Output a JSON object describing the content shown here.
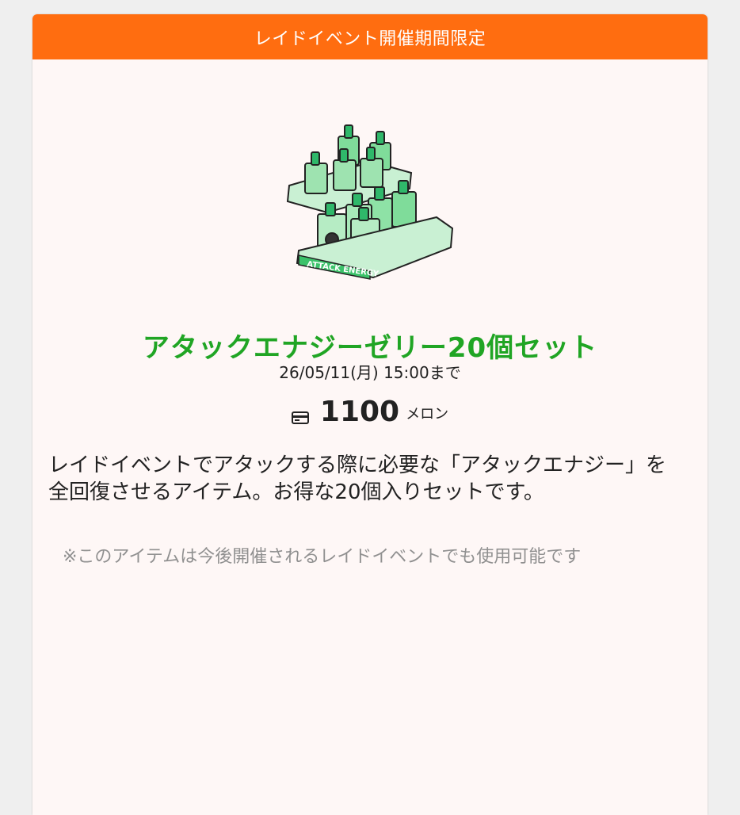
{
  "banner": {
    "label": "レイドイベント開催期間限定"
  },
  "item": {
    "name": "アタックエナジーゼリー20個セット",
    "deadline": "26/05/11(月) 15:00まで",
    "price": "1100",
    "price_unit": "メロン",
    "image_text": "ATTACK ENERGY",
    "description": "レイドイベントでアタックする際に必要な「アタックエナジー」を全回復させるアイテム。お得な20個入りセットです。",
    "note": "※このアイテムは今後開催されるレイドイベントでも使用可能です"
  },
  "colors": {
    "banner": "#ff6d10",
    "item_name": "#20a524",
    "note": "#909090",
    "card_background": "#fef7f6"
  },
  "icons": {
    "price": "credit-card-icon"
  }
}
